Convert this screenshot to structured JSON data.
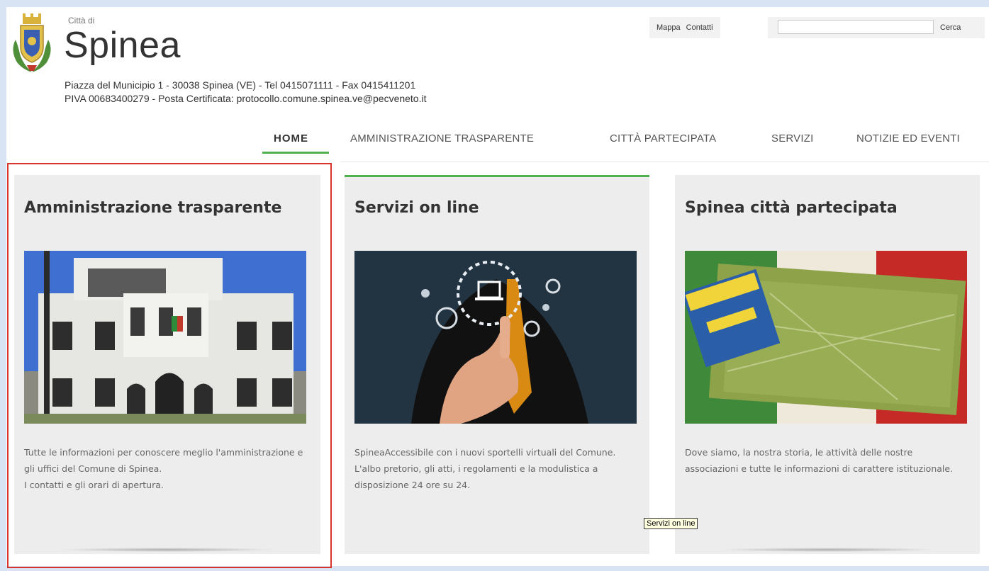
{
  "header": {
    "citta_di": "Città di",
    "site_name": "Spinea",
    "address_line1": "Piazza del Municipio 1 - 30038 Spinea (VE) - Tel 0415071111 - Fax 0415411201",
    "address_line2": "PIVA 00683400279 - Posta Certificata: protocollo.comune.spinea.ve@pecveneto.it",
    "crest_icon": "coat-of-arms-icon"
  },
  "utility": {
    "mappa": "Mappa",
    "contatti": "Contatti"
  },
  "search": {
    "value": "",
    "placeholder": "",
    "button_label": "Cerca"
  },
  "nav": {
    "items": [
      {
        "label": "HOME",
        "active": true
      },
      {
        "label": "AMMINISTRAZIONE TRASPARENTE",
        "active": false
      },
      {
        "label": "CITTÀ PARTECIPATA",
        "active": false
      },
      {
        "label": "SERVIZI",
        "active": false
      },
      {
        "label": "NOTIZIE ED EVENTI",
        "active": false
      }
    ]
  },
  "cards": [
    {
      "title": "Amministrazione trasparente",
      "text": [
        "Tutte le informazioni per conoscere meglio l'amministrazione e gli uffici del Comune di Spinea.",
        "I contatti e gli orari di apertura."
      ]
    },
    {
      "title": "Servizi on line",
      "text": [
        "SpineaAccessibile con i nuovi sportelli virtuali del Comune.",
        "L'albo pretorio, gli atti, i regolamenti e la modulistica a disposizione 24 ore su 24."
      ]
    },
    {
      "title": "Spinea città partecipata",
      "text": [
        "Dove siamo, la nostra storia, le attività delle nostre associazioni e tutte le informazioni di carattere istituzionale."
      ]
    }
  ],
  "tooltip": "Servizi on line",
  "colors": {
    "accent_green": "#4fb04f",
    "highlight_red": "#d9342b",
    "card_bg": "#ededed",
    "frame_blue": "#d8e4f3"
  }
}
